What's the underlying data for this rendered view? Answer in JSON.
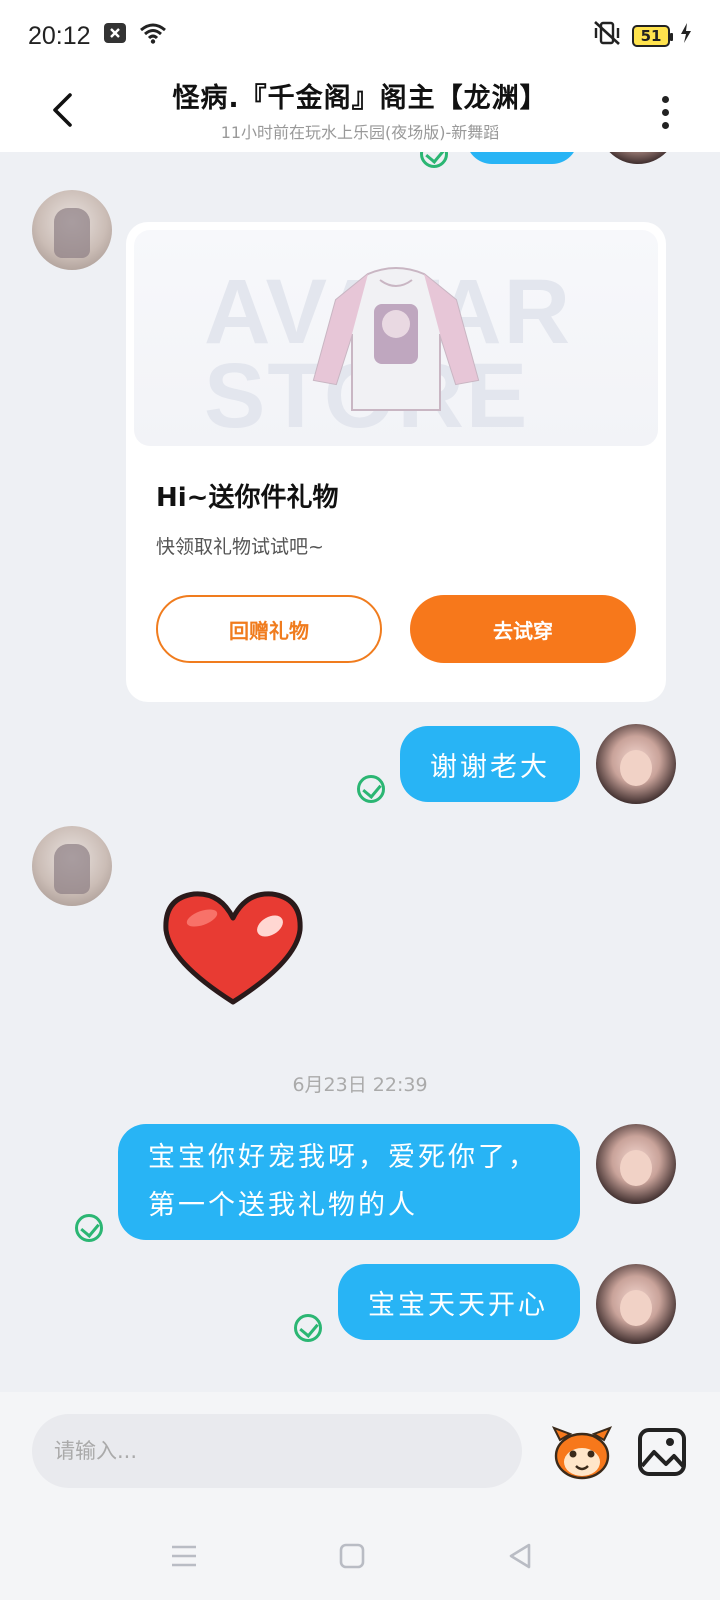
{
  "status_bar": {
    "time": "20:12",
    "battery": "51"
  },
  "header": {
    "title": "怪病.『千金阁』阁主【龙渊】",
    "subtitle": "11小时前在玩水上乐园(夜场版)-新舞蹈"
  },
  "gift_card": {
    "watermark": "AVATAR STORE",
    "title": "Hi~送你件礼物",
    "description": "快领取礼物试试吧~",
    "return_gift_label": "回赠礼物",
    "try_on_label": "去试穿"
  },
  "messages": [
    {
      "sender": "me",
      "text": "谢谢老大"
    },
    {
      "sender": "other",
      "sticker": "heart-sticker"
    },
    {
      "sender": "me",
      "text": "宝宝你好宠我呀，爱死你了，第一个送我礼物的人"
    },
    {
      "sender": "me",
      "text": "宝宝天天开心"
    }
  ],
  "timestamp": "6月23日 22:39",
  "input": {
    "placeholder": "请输入..."
  },
  "colors": {
    "bubble": "#28b4f5",
    "accent": "#f7781b",
    "check": "#2bb673"
  }
}
